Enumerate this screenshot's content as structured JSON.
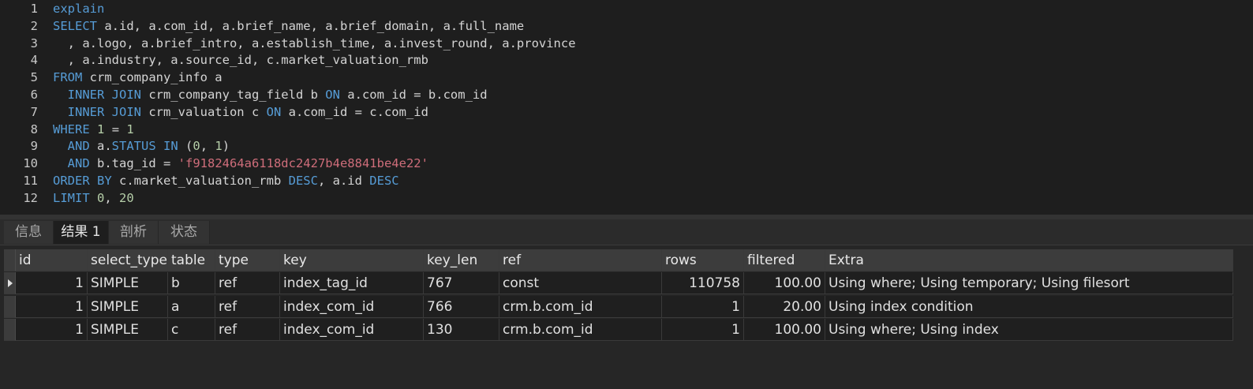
{
  "editor": {
    "lines": [
      {
        "n": "1",
        "tokens": [
          {
            "t": "explain",
            "c": "kw"
          }
        ]
      },
      {
        "n": "2",
        "tokens": [
          {
            "t": "SELECT",
            "c": "kw"
          },
          {
            "t": " a.id, a.com_id, a.brief_name, a.brief_domain, a.full_name",
            "c": "plain"
          }
        ]
      },
      {
        "n": "3",
        "tokens": [
          {
            "t": "  , a.logo, a.brief_intro, a.establish_time, a.invest_round, a.province",
            "c": "plain"
          }
        ]
      },
      {
        "n": "4",
        "tokens": [
          {
            "t": "  , a.industry, a.source_id, c.market_valuation_rmb",
            "c": "plain"
          }
        ]
      },
      {
        "n": "5",
        "tokens": [
          {
            "t": "FROM",
            "c": "kw"
          },
          {
            "t": " crm_company_info a",
            "c": "plain"
          }
        ]
      },
      {
        "n": "6",
        "tokens": [
          {
            "t": "  INNER JOIN",
            "c": "kw"
          },
          {
            "t": " crm_company_tag_field b ",
            "c": "plain"
          },
          {
            "t": "ON",
            "c": "kw"
          },
          {
            "t": " a.com_id = b.com_id",
            "c": "plain"
          }
        ]
      },
      {
        "n": "7",
        "tokens": [
          {
            "t": "  INNER JOIN",
            "c": "kw"
          },
          {
            "t": " crm_valuation c ",
            "c": "plain"
          },
          {
            "t": "ON",
            "c": "kw"
          },
          {
            "t": " a.com_id = c.com_id",
            "c": "plain"
          }
        ]
      },
      {
        "n": "8",
        "tokens": [
          {
            "t": "WHERE",
            "c": "kw"
          },
          {
            "t": " ",
            "c": "plain"
          },
          {
            "t": "1",
            "c": "num"
          },
          {
            "t": " = ",
            "c": "plain"
          },
          {
            "t": "1",
            "c": "num"
          }
        ]
      },
      {
        "n": "9",
        "tokens": [
          {
            "t": "  AND",
            "c": "kw"
          },
          {
            "t": " a.",
            "c": "plain"
          },
          {
            "t": "STATUS",
            "c": "kw"
          },
          {
            "t": " ",
            "c": "plain"
          },
          {
            "t": "IN",
            "c": "kw"
          },
          {
            "t": " (",
            "c": "plain"
          },
          {
            "t": "0",
            "c": "num"
          },
          {
            "t": ", ",
            "c": "plain"
          },
          {
            "t": "1",
            "c": "num"
          },
          {
            "t": ")",
            "c": "plain"
          }
        ]
      },
      {
        "n": "10",
        "tokens": [
          {
            "t": "  AND",
            "c": "kw"
          },
          {
            "t": " b.tag_id = ",
            "c": "plain"
          },
          {
            "t": "'f9182464a6118dc2427b4e8841be4e22'",
            "c": "str"
          }
        ]
      },
      {
        "n": "11",
        "tokens": [
          {
            "t": "ORDER BY",
            "c": "kw"
          },
          {
            "t": " c.market_valuation_rmb ",
            "c": "plain"
          },
          {
            "t": "DESC",
            "c": "kw"
          },
          {
            "t": ", a.id ",
            "c": "plain"
          },
          {
            "t": "DESC",
            "c": "kw"
          }
        ]
      },
      {
        "n": "12",
        "tokens": [
          {
            "t": "LIMIT",
            "c": "kw"
          },
          {
            "t": " ",
            "c": "plain"
          },
          {
            "t": "0",
            "c": "num"
          },
          {
            "t": ", ",
            "c": "plain"
          },
          {
            "t": "20",
            "c": "num"
          }
        ]
      }
    ]
  },
  "tabs": [
    {
      "label": "信息",
      "active": false
    },
    {
      "label": "结果 1",
      "active": true
    },
    {
      "label": "剖析",
      "active": false
    },
    {
      "label": "状态",
      "active": false
    }
  ],
  "results": {
    "columns": [
      "id",
      "select_type",
      "table",
      "type",
      "key",
      "key_len",
      "ref",
      "rows",
      "filtered",
      "Extra"
    ],
    "rows": [
      [
        "1",
        "SIMPLE",
        "b",
        "ref",
        "index_tag_id",
        "767",
        "const",
        "110758",
        "100.00",
        "Using where; Using temporary; Using filesort"
      ],
      [
        "1",
        "SIMPLE",
        "a",
        "ref",
        "index_com_id",
        "766",
        "crm.b.com_id",
        "1",
        "20.00",
        "Using index condition"
      ],
      [
        "1",
        "SIMPLE",
        "c",
        "ref",
        "index_com_id",
        "130",
        "crm.b.com_id",
        "1",
        "100.00",
        "Using where; Using index"
      ]
    ],
    "selected_row": 0
  }
}
